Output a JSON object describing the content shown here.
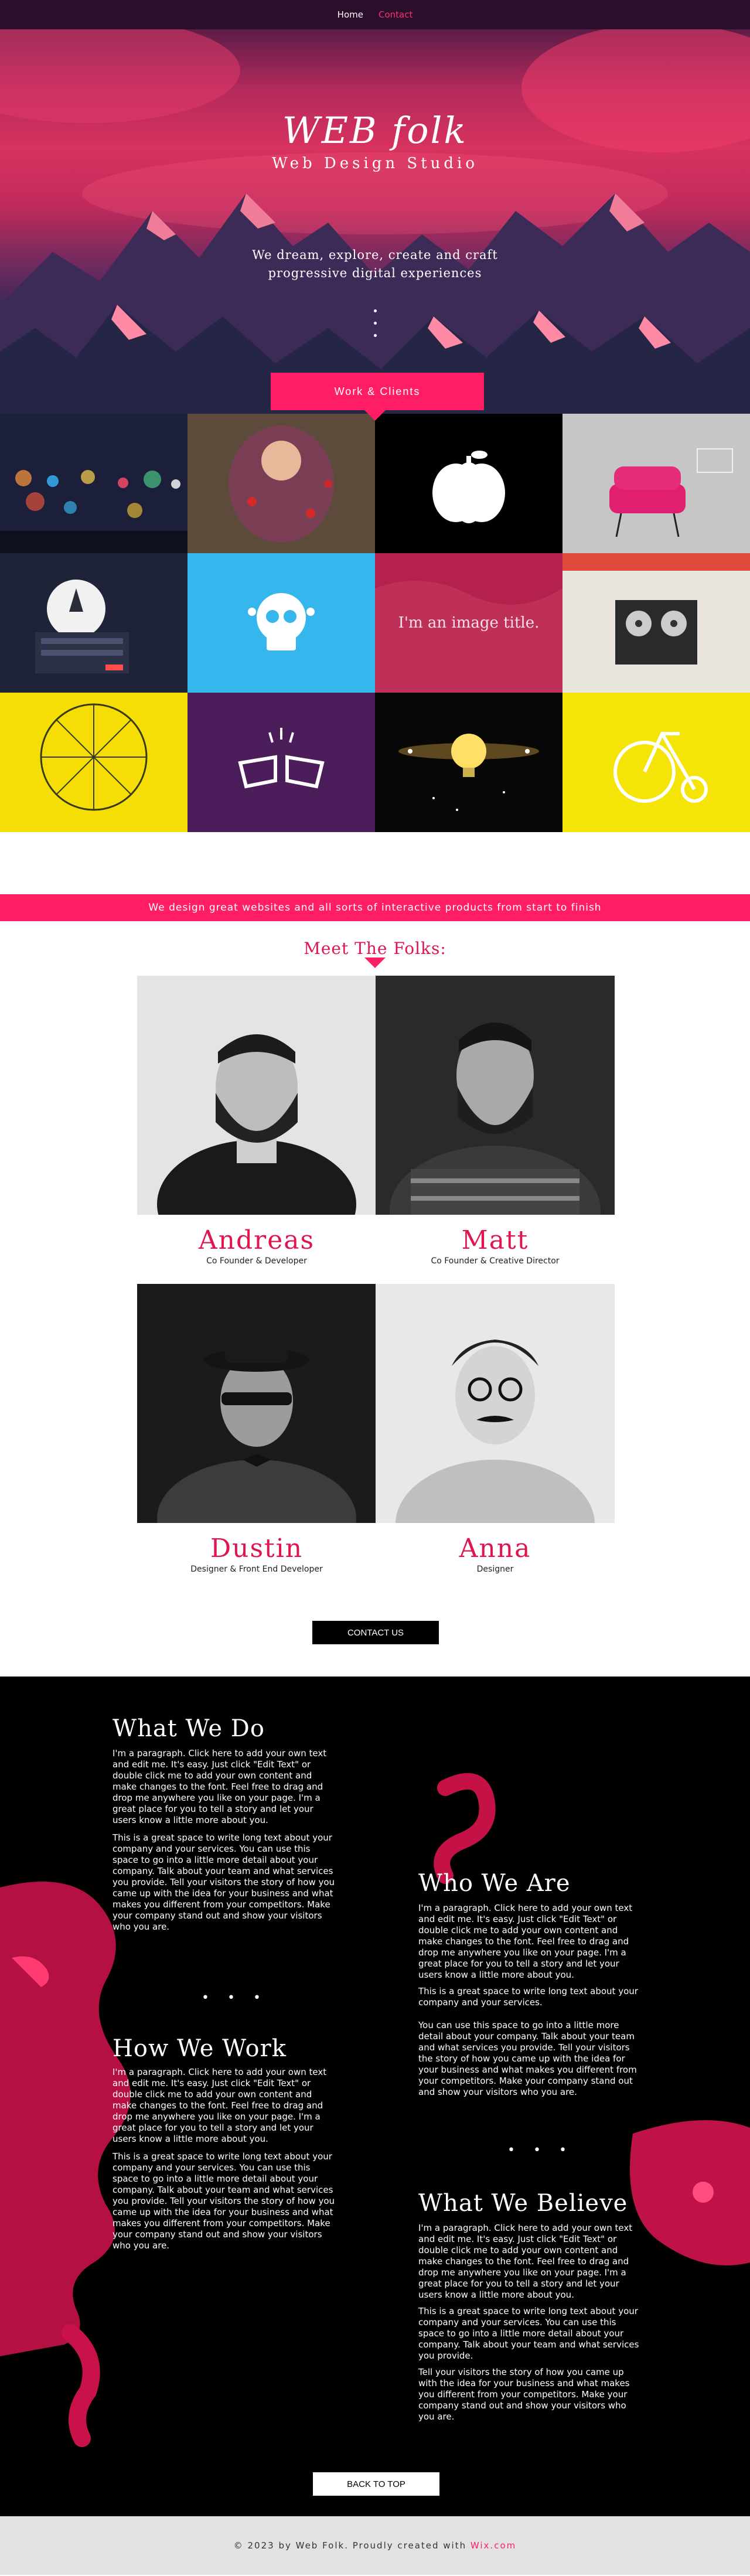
{
  "nav": {
    "items": [
      {
        "label": "Home"
      },
      {
        "label": "Contact"
      }
    ]
  },
  "hero": {
    "brand": "WEB folk",
    "subtitle": "Web Design Studio",
    "tagline_line1": "We dream, explore, create and craft",
    "tagline_line2": "progressive digital experiences",
    "work_button": "Work & Clients"
  },
  "gallery": {
    "tiles": [
      {
        "name": "city-lights-photo",
        "bg": "#1b1f3a"
      },
      {
        "name": "girl-with-apples-photo",
        "bg": "#5a4a3a"
      },
      {
        "name": "pumpkin-icon",
        "bg": "#000000"
      },
      {
        "name": "pink-chair-photo",
        "bg": "#c9c9c9"
      },
      {
        "name": "rocket-webpage-photo",
        "bg": "#1d2236"
      },
      {
        "name": "skull-icon",
        "bg": "#35b6ec"
      },
      {
        "name": "image-title-tile",
        "bg": "#b0204a",
        "caption": "I'm an image title."
      },
      {
        "name": "tape-recorder-photo",
        "bg": "#e8e3da"
      },
      {
        "name": "ferris-wheel-photo",
        "bg": "#f7dc00"
      },
      {
        "name": "angel-wings-icon",
        "bg": "#4b1d5b"
      },
      {
        "name": "lightbulb-photo",
        "bg": "#0a0a0a"
      },
      {
        "name": "bicycle-icon",
        "bg": "#f5e407"
      }
    ]
  },
  "banner": {
    "text": "We design great websites and all sorts of interactive products from start to finish"
  },
  "team": {
    "title": "Meet The Folks:",
    "members": [
      {
        "name": "Andreas",
        "role": "Co Founder & Developer"
      },
      {
        "name": "Matt",
        "role": "Co Founder & Creative Director"
      },
      {
        "name": "Dustin",
        "role": "Designer & Front End Developer"
      },
      {
        "name": "Anna",
        "role": "Designer"
      }
    ],
    "contact_button": "CONTACT US"
  },
  "about": {
    "what_we_do": {
      "title": "What We Do",
      "text": "I'm a paragraph. Click here to add your own text and edit me. It's easy. Just click \"Edit Text\" or double click me to add your own content and make changes to the font. Feel free to drag and drop me anywhere you like on your page. I'm a great place for you to tell a story and let your users know a little more about you.",
      "text2": "This is a great space to write long text about your company and your services. You can use this space to go into a little more detail about your company. Talk about your team and what services you provide. Tell your visitors the story of how you came up with the idea for your business and what makes you different from your competitors. Make your company stand out and show your visitors who you are."
    },
    "who_we_are": {
      "title": "Who We Are",
      "text": "I'm a paragraph. Click here to add your own text and edit me. It's easy. Just click \"Edit Text\" or double click me to add your own content and make changes to the font. Feel free to drag and drop me anywhere you like on your page. I'm a great place for you to tell a story and let your users know a little more about you.",
      "text2": "This is a great space to write long text about your company and your services.",
      "text3": "You can use this space to go into a little more detail about your company. Talk about your team and what services you provide. Tell your visitors the story of how you came up with the idea for your business and what makes you different from your competitors. Make your company stand out and show your visitors who you are."
    },
    "how_we_work": {
      "title": "How We Work",
      "text": "I'm a paragraph. Click here to add your own text and edit me. It's easy. Just click \"Edit Text\" or double click me to add your own content and make changes to the font. Feel free to drag and drop me anywhere you like on your page. I'm a great place for you to tell a story and let your users know a little more about you.",
      "text2": "This is a great space to write long text about your company and your services. You can use this space to go into a little more detail about your company. Talk about your team and what services you provide. Tell your visitors the story of how you came up with the idea for your business and what makes you different from your competitors. Make your company stand out and show your visitors who you are."
    },
    "what_we_believe": {
      "title": "What We Believe",
      "text": "I'm a paragraph. Click here to add your own text and edit me. It's easy. Just click \"Edit Text\" or double click me to add your own content and make changes to the font. Feel free to drag and drop me anywhere you like on your page. I'm a great place for you to tell a story and let your users know a little more about you.",
      "text2": "This is a great space to write long text about your company and your services. You can use this space to go into a little more detail about your company. Talk about your team and what services you provide.",
      "text3": "Tell your visitors the story of how you came up with the idea for your business and what makes you different from your competitors. Make your company stand out and show your visitors who you are."
    },
    "separator": "• • •",
    "back_to_top": "BACK TO TOP"
  },
  "footer": {
    "text": "© 2023 by Web Folk. Proudly created with",
    "link": "Wix.com"
  },
  "colors": {
    "accent": "#ff1e64",
    "dark": "#000000",
    "nav": "#2a0f2c"
  }
}
